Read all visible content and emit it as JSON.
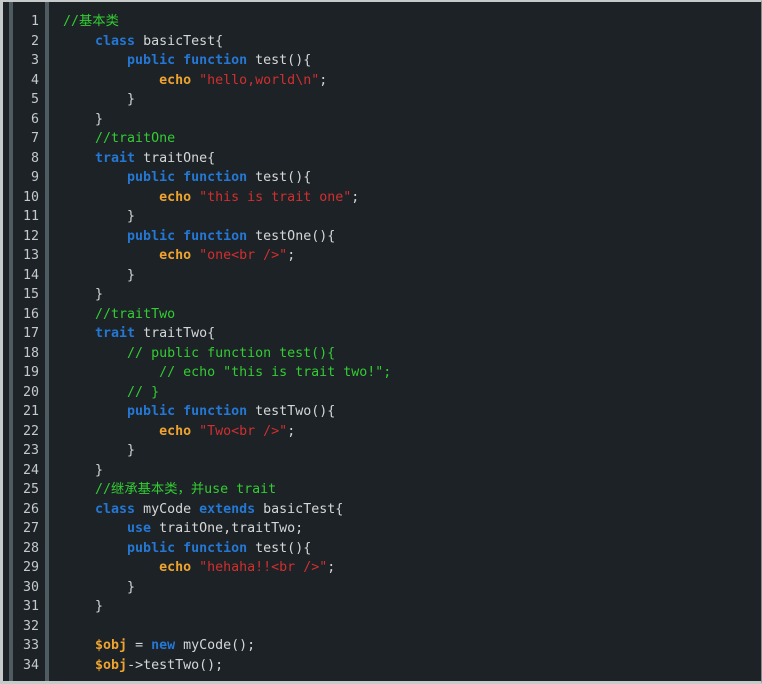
{
  "editor": {
    "language": "php",
    "colors": {
      "bg": "#1c2226",
      "frame": "#c6cacb",
      "gutterBar": "#4e5b61",
      "lineNumber": "#c5c9cb",
      "plain": "#d5d7d7",
      "comment": "#33cc33",
      "keyword": "#2577d4",
      "builtin": "#efa32f",
      "string": "#d22f2f"
    },
    "lines": [
      {
        "num": "1",
        "segments": [
          [
            "comment",
            "//基本类"
          ]
        ]
      },
      {
        "num": "2",
        "segments": [
          [
            "plain",
            "    "
          ],
          [
            "keyword",
            "class"
          ],
          [
            "plain",
            " basicTest{"
          ]
        ]
      },
      {
        "num": "3",
        "segments": [
          [
            "plain",
            "        "
          ],
          [
            "keyword",
            "public"
          ],
          [
            "plain",
            " "
          ],
          [
            "keyword",
            "function"
          ],
          [
            "plain",
            " test(){"
          ]
        ]
      },
      {
        "num": "4",
        "segments": [
          [
            "plain",
            "            "
          ],
          [
            "builtin",
            "echo"
          ],
          [
            "plain",
            " "
          ],
          [
            "string",
            "\"hello,world\\n\""
          ],
          [
            "plain",
            ";"
          ]
        ]
      },
      {
        "num": "5",
        "segments": [
          [
            "plain",
            "        }"
          ]
        ]
      },
      {
        "num": "6",
        "segments": [
          [
            "plain",
            "    }"
          ]
        ]
      },
      {
        "num": "7",
        "segments": [
          [
            "plain",
            "    "
          ],
          [
            "comment",
            "//traitOne"
          ]
        ]
      },
      {
        "num": "8",
        "segments": [
          [
            "plain",
            "    "
          ],
          [
            "keyword",
            "trait"
          ],
          [
            "plain",
            " traitOne{"
          ]
        ]
      },
      {
        "num": "9",
        "segments": [
          [
            "plain",
            "        "
          ],
          [
            "keyword",
            "public"
          ],
          [
            "plain",
            " "
          ],
          [
            "keyword",
            "function"
          ],
          [
            "plain",
            " test(){"
          ]
        ]
      },
      {
        "num": "10",
        "segments": [
          [
            "plain",
            "            "
          ],
          [
            "builtin",
            "echo"
          ],
          [
            "plain",
            " "
          ],
          [
            "string",
            "\"this is trait one\""
          ],
          [
            "plain",
            ";"
          ]
        ]
      },
      {
        "num": "11",
        "segments": [
          [
            "plain",
            "        }"
          ]
        ]
      },
      {
        "num": "12",
        "segments": [
          [
            "plain",
            "        "
          ],
          [
            "keyword",
            "public"
          ],
          [
            "plain",
            " "
          ],
          [
            "keyword",
            "function"
          ],
          [
            "plain",
            " testOne(){"
          ]
        ]
      },
      {
        "num": "13",
        "segments": [
          [
            "plain",
            "            "
          ],
          [
            "builtin",
            "echo"
          ],
          [
            "plain",
            " "
          ],
          [
            "string",
            "\"one<br />\""
          ],
          [
            "plain",
            ";"
          ]
        ]
      },
      {
        "num": "14",
        "segments": [
          [
            "plain",
            "        }"
          ]
        ]
      },
      {
        "num": "15",
        "segments": [
          [
            "plain",
            "    }"
          ]
        ]
      },
      {
        "num": "16",
        "segments": [
          [
            "plain",
            "    "
          ],
          [
            "comment",
            "//traitTwo"
          ]
        ]
      },
      {
        "num": "17",
        "segments": [
          [
            "plain",
            "    "
          ],
          [
            "keyword",
            "trait"
          ],
          [
            "plain",
            " traitTwo{"
          ]
        ]
      },
      {
        "num": "18",
        "segments": [
          [
            "plain",
            "        "
          ],
          [
            "comment",
            "// public function test(){"
          ]
        ]
      },
      {
        "num": "19",
        "segments": [
          [
            "plain",
            "            "
          ],
          [
            "comment",
            "// echo \"this is trait two!\";"
          ]
        ]
      },
      {
        "num": "20",
        "segments": [
          [
            "plain",
            "        "
          ],
          [
            "comment",
            "// }"
          ]
        ]
      },
      {
        "num": "21",
        "segments": [
          [
            "plain",
            "        "
          ],
          [
            "keyword",
            "public"
          ],
          [
            "plain",
            " "
          ],
          [
            "keyword",
            "function"
          ],
          [
            "plain",
            " testTwo(){"
          ]
        ]
      },
      {
        "num": "22",
        "segments": [
          [
            "plain",
            "            "
          ],
          [
            "builtin",
            "echo"
          ],
          [
            "plain",
            " "
          ],
          [
            "string",
            "\"Two<br />\""
          ],
          [
            "plain",
            ";"
          ]
        ]
      },
      {
        "num": "23",
        "segments": [
          [
            "plain",
            "        }"
          ]
        ]
      },
      {
        "num": "24",
        "segments": [
          [
            "plain",
            "    }"
          ]
        ]
      },
      {
        "num": "25",
        "segments": [
          [
            "plain",
            "    "
          ],
          [
            "comment",
            "//继承基本类，并use trait"
          ]
        ]
      },
      {
        "num": "26",
        "segments": [
          [
            "plain",
            "    "
          ],
          [
            "keyword",
            "class"
          ],
          [
            "plain",
            " myCode "
          ],
          [
            "keyword",
            "extends"
          ],
          [
            "plain",
            " basicTest{"
          ]
        ]
      },
      {
        "num": "27",
        "segments": [
          [
            "plain",
            "        "
          ],
          [
            "keyword",
            "use"
          ],
          [
            "plain",
            " traitOne,traitTwo;"
          ]
        ]
      },
      {
        "num": "28",
        "segments": [
          [
            "plain",
            "        "
          ],
          [
            "keyword",
            "public"
          ],
          [
            "plain",
            " "
          ],
          [
            "keyword",
            "function"
          ],
          [
            "plain",
            " test(){"
          ]
        ]
      },
      {
        "num": "29",
        "segments": [
          [
            "plain",
            "            "
          ],
          [
            "builtin",
            "echo"
          ],
          [
            "plain",
            " "
          ],
          [
            "string",
            "\"hehaha!!<br />\""
          ],
          [
            "plain",
            ";"
          ]
        ]
      },
      {
        "num": "30",
        "segments": [
          [
            "plain",
            "        }"
          ]
        ]
      },
      {
        "num": "31",
        "segments": [
          [
            "plain",
            "    }"
          ]
        ]
      },
      {
        "num": "32",
        "segments": []
      },
      {
        "num": "33",
        "segments": [
          [
            "plain",
            "    "
          ],
          [
            "builtin",
            "$obj"
          ],
          [
            "plain",
            " = "
          ],
          [
            "keyword",
            "new"
          ],
          [
            "plain",
            " myCode();"
          ]
        ]
      },
      {
        "num": "34",
        "segments": [
          [
            "plain",
            "    "
          ],
          [
            "builtin",
            "$obj"
          ],
          [
            "plain",
            "->testTwo();"
          ]
        ]
      }
    ]
  }
}
